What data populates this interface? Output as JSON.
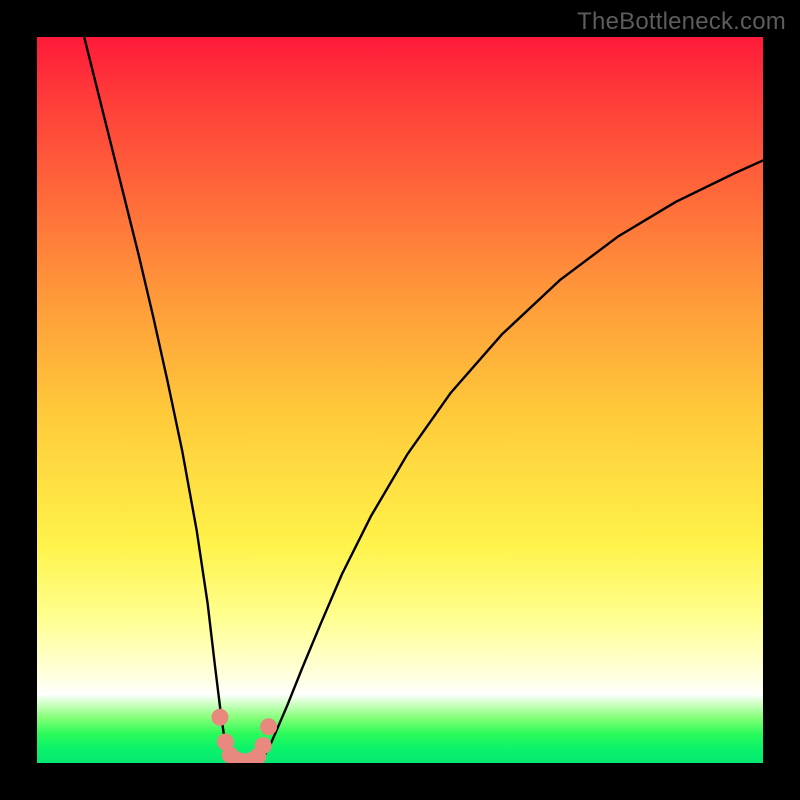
{
  "attribution": "TheBottleneck.com",
  "colors": {
    "frame": "#000000",
    "curve": "#000000",
    "marker_fill": "#e9887e",
    "marker_stroke": "#db6b63"
  },
  "chart_data": {
    "type": "line",
    "title": "",
    "xlabel": "",
    "ylabel": "",
    "xlim": [
      0,
      100
    ],
    "ylim": [
      0,
      100
    ],
    "annotations": [],
    "series": [
      {
        "name": "left-branch",
        "x": [
          6.5,
          8,
          10,
          12,
          14,
          16,
          18,
          20,
          22,
          23.5,
          24.5,
          25.3,
          25.8,
          26.2,
          26.6
        ],
        "y": [
          100,
          94,
          86,
          78,
          70,
          61.5,
          52.5,
          43,
          32,
          22,
          13.5,
          7,
          3.5,
          1.6,
          0.8
        ]
      },
      {
        "name": "bottom",
        "x": [
          26.6,
          27.1,
          27.7,
          28.3,
          28.9,
          29.5,
          30.1,
          30.7,
          31.3
        ],
        "y": [
          0.8,
          0.35,
          0.12,
          0.05,
          0.03,
          0.05,
          0.15,
          0.45,
          1.0
        ]
      },
      {
        "name": "right-branch",
        "x": [
          31.3,
          32,
          33,
          34.5,
          36.5,
          39,
          42,
          46,
          51,
          57,
          64,
          72,
          80,
          88,
          96,
          100
        ],
        "y": [
          1.0,
          2.2,
          4.5,
          8,
          13,
          19,
          26,
          34,
          42.5,
          51,
          59,
          66.5,
          72.5,
          77.3,
          81.2,
          83
        ]
      }
    ],
    "markers": {
      "name": "highlight-points",
      "x": [
        25.2,
        25.95,
        26.6,
        27.5,
        28.5,
        29.6,
        30.4,
        31.15,
        31.9
      ],
      "y": [
        6.3,
        2.9,
        1.1,
        0.35,
        0.1,
        0.3,
        0.9,
        2.4,
        5.0
      ],
      "r": [
        8.5,
        8.5,
        8.5,
        9,
        9,
        9,
        8.5,
        8.5,
        8.5
      ]
    }
  }
}
